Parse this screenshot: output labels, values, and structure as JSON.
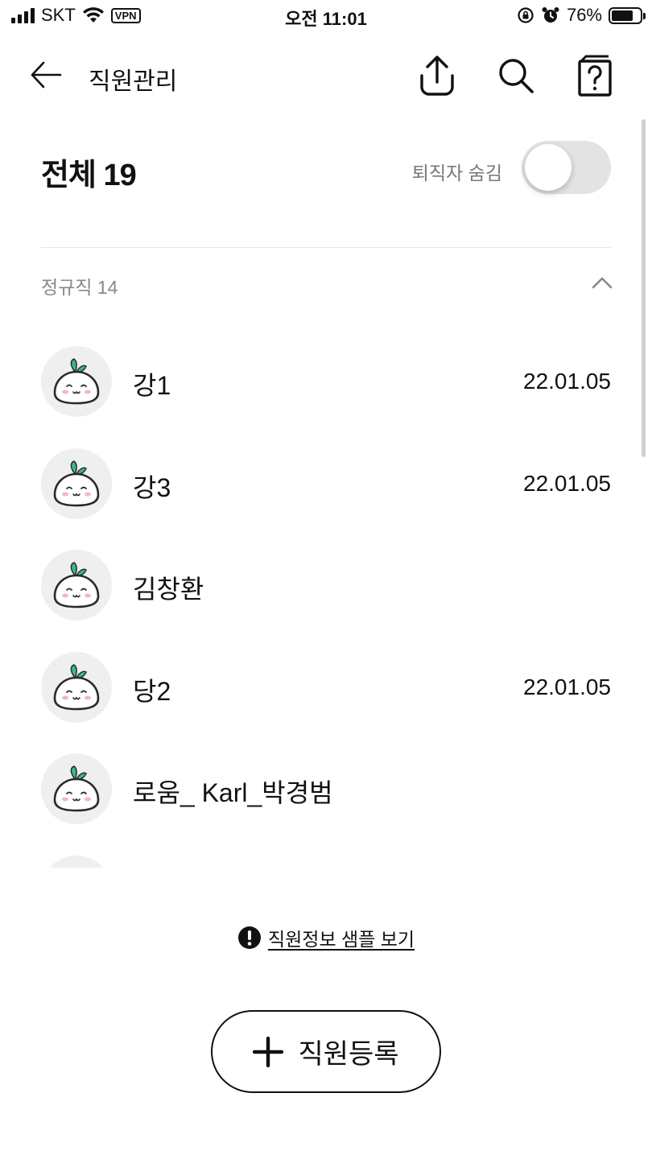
{
  "status_bar": {
    "carrier": "SKT",
    "vpn": "VPN",
    "time": "오전 11:01",
    "battery": "76%",
    "battery_level": 0.76
  },
  "header": {
    "title": "직원관리",
    "icons": [
      "back-arrow-icon",
      "share-icon",
      "search-icon",
      "help-book-icon"
    ]
  },
  "summary": {
    "total_label": "전체 19",
    "hide_retired_label": "퇴직자 숨김",
    "hide_retired_on": false
  },
  "section": {
    "title": "정규직 14",
    "expanded": true
  },
  "employees": [
    {
      "name": "강1",
      "date": "22.01.05"
    },
    {
      "name": "강3",
      "date": "22.01.05"
    },
    {
      "name": "김창환",
      "date": ""
    },
    {
      "name": "당2",
      "date": "22.01.05"
    },
    {
      "name": "로움_ Karl_박경범",
      "date": ""
    },
    {
      "name": "",
      "date": ""
    }
  ],
  "footer": {
    "sample_link": "직원정보 샘플 보기",
    "register_label": "직원등록"
  },
  "colors": {
    "accent_leaf": "#3bb98a",
    "toggle_off": "#e3e3e3",
    "avatar_bg": "#efefef"
  }
}
